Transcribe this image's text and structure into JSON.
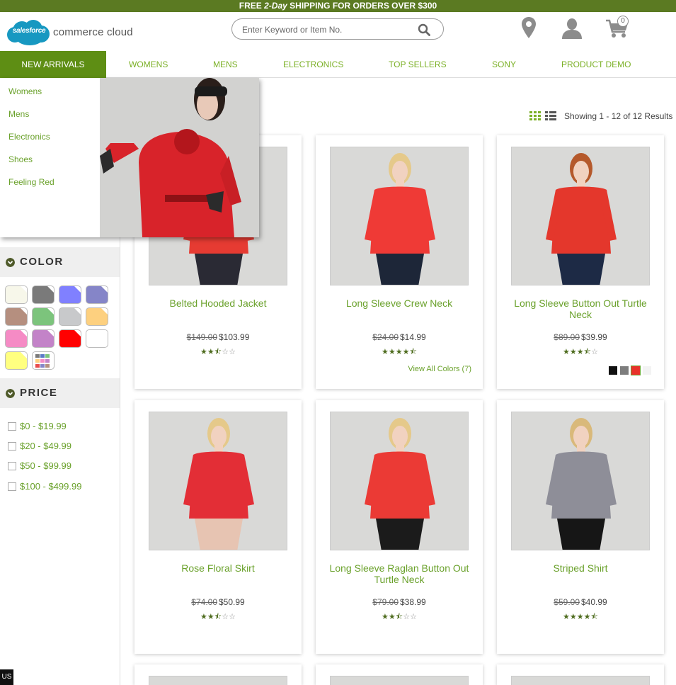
{
  "promo": {
    "prefix": "FREE ",
    "emph": "2-Day",
    "suffix": " SHIPPING FOR ORDERS OVER $300"
  },
  "logo": {
    "cloud_text": "salesforce",
    "text": "commerce cloud"
  },
  "search": {
    "placeholder": "Enter Keyword or Item No.",
    "value": ""
  },
  "header_icons": {
    "store": "location-pin-icon",
    "account": "user-icon",
    "cart": "cart-icon",
    "cart_count": "0"
  },
  "nav": {
    "items": [
      {
        "label": "NEW ARRIVALS",
        "active": true
      },
      {
        "label": "WOMENS"
      },
      {
        "label": "MENS"
      },
      {
        "label": "ELECTRONICS"
      },
      {
        "label": "TOP SELLERS"
      },
      {
        "label": "SONY"
      },
      {
        "label": "PRODUCT DEMO"
      }
    ]
  },
  "dropdown": {
    "links": [
      "Womens",
      "Mens",
      "Electronics",
      "Shoes",
      "Feeling Red"
    ]
  },
  "refinements": {
    "color": {
      "title": "COLOR",
      "swatches": [
        "#f7f7ea",
        "#7a7a7a",
        "#8080ff",
        "#8585c8",
        "#b58f7f",
        "#7cc47c",
        "#c8c9cb",
        "#fdd07f",
        "#f58bc5",
        "#c383c8",
        "#ff0000",
        "#ffffff",
        "#ffff80",
        "miscellaneous"
      ]
    },
    "price": {
      "title": "PRICE",
      "options": [
        "$0 - $19.99",
        "$20 - $49.99",
        "$50 - $99.99",
        "$100 - $499.99"
      ]
    }
  },
  "results": {
    "text": "Showing 1 - 12 of 12 Results"
  },
  "products": [
    {
      "name": "Belted Hooded Jacket",
      "std": "$149.00",
      "sale": "$103.99",
      "rating": 2.5
    },
    {
      "name": "Long Sleeve Crew Neck",
      "std": "$24.00",
      "sale": "$14.99",
      "rating": 4.5,
      "colors_link": "View All Colors (7)"
    },
    {
      "name": "Long Sleeve Button Out Turtle Neck",
      "std": "$89.00",
      "sale": "$39.99",
      "rating": 3.5,
      "chips": [
        "#111111",
        "#7d7d7d",
        "#e8312a",
        "#f3f3f3"
      ]
    },
    {
      "name": "Rose Floral Skirt",
      "std": "$74.00",
      "sale": "$50.99",
      "rating": 2.5
    },
    {
      "name": "Long Sleeve Raglan Button Out Turtle Neck",
      "std": "$79.00",
      "sale": "$38.99",
      "rating": 2.5
    },
    {
      "name": "Striped Shirt",
      "std": "$59.00",
      "sale": "$40.99",
      "rating": 4.5
    }
  ],
  "locale": {
    "badge": "US"
  }
}
